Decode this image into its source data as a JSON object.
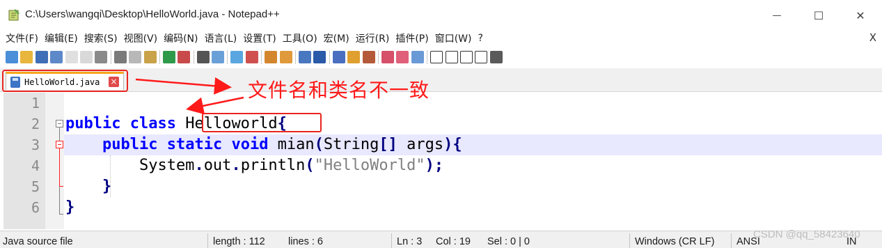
{
  "window": {
    "title": "C:\\Users\\wangqi\\Desktop\\HelloWorld.java - Notepad++",
    "min_glyph": "—",
    "max_glyph": "☐",
    "close_glyph": "✕"
  },
  "menu": {
    "items": [
      "文件(F)",
      "编辑(E)",
      "搜索(S)",
      "视图(V)",
      "编码(N)",
      "语言(L)",
      "设置(T)",
      "工具(O)",
      "宏(M)",
      "运行(R)",
      "插件(P)",
      "窗口(W)",
      "?"
    ],
    "close_label": "X"
  },
  "toolbar": {
    "icons": [
      "new-file-icon",
      "open-file-icon",
      "save-icon",
      "save-all-icon",
      "close-icon",
      "close-all-icon",
      "print-icon",
      "cut-icon",
      "copy-icon",
      "paste-icon",
      "undo-icon",
      "redo-icon",
      "find-icon",
      "replace-icon",
      "zoom-in-icon",
      "zoom-out-icon",
      "sync-vertical-icon",
      "sync-horizontal-icon",
      "word-wrap-icon",
      "show-all-chars-icon",
      "indent-guide-icon",
      "function-list-icon",
      "doc-map-icon",
      "folder-workspace-icon",
      "doc-list-icon",
      "monitor-icon",
      "record-macro-icon",
      "stop-macro-icon",
      "play-macro-icon",
      "run-macro-multiple-icon",
      "save-macro-icon"
    ]
  },
  "tab": {
    "label": "HelloWorld.java",
    "close_glyph": "×"
  },
  "annotation": {
    "text": "文件名和类名不一致"
  },
  "editor": {
    "lines": [
      {
        "num": "1"
      },
      {
        "num": "2",
        "tokens": [
          [
            "kw-b",
            "public"
          ],
          [
            "plain",
            " "
          ],
          [
            "kw-b",
            "class"
          ],
          [
            "plain",
            " Helloworld"
          ],
          [
            "op",
            "{"
          ]
        ]
      },
      {
        "num": "3",
        "tokens": [
          [
            "plain",
            "    "
          ],
          [
            "kw-b",
            "public"
          ],
          [
            "plain",
            " "
          ],
          [
            "kw-b",
            "static"
          ],
          [
            "plain",
            " "
          ],
          [
            "kw-b",
            "void"
          ],
          [
            "plain",
            " mian"
          ],
          [
            "op",
            "("
          ],
          [
            "plain",
            "String"
          ],
          [
            "op",
            "[]"
          ],
          [
            "plain",
            " args"
          ],
          [
            "op",
            ")"
          ],
          [
            "op",
            "{"
          ]
        ]
      },
      {
        "num": "4",
        "tokens": [
          [
            "plain",
            "        System"
          ],
          [
            "op",
            "."
          ],
          [
            "plain",
            "out"
          ],
          [
            "op",
            "."
          ],
          [
            "plain",
            "println"
          ],
          [
            "op",
            "("
          ],
          [
            "str",
            "\"HelloWorld\""
          ],
          [
            "op",
            ");"
          ]
        ]
      },
      {
        "num": "5",
        "tokens": [
          [
            "plain",
            "    "
          ],
          [
            "op",
            "}"
          ]
        ]
      },
      {
        "num": "6",
        "tokens": [
          [
            "op",
            "}"
          ]
        ]
      }
    ]
  },
  "status": {
    "file_type": "Java source file",
    "length": "length : 112",
    "lines": "lines : 6",
    "ln": "Ln : 3",
    "col": "Col : 19",
    "sel": "Sel : 0 | 0",
    "eol": "Windows (CR LF)",
    "encoding": "ANSI",
    "mode": "IN"
  },
  "watermark": "CSDN @qq_58423640"
}
